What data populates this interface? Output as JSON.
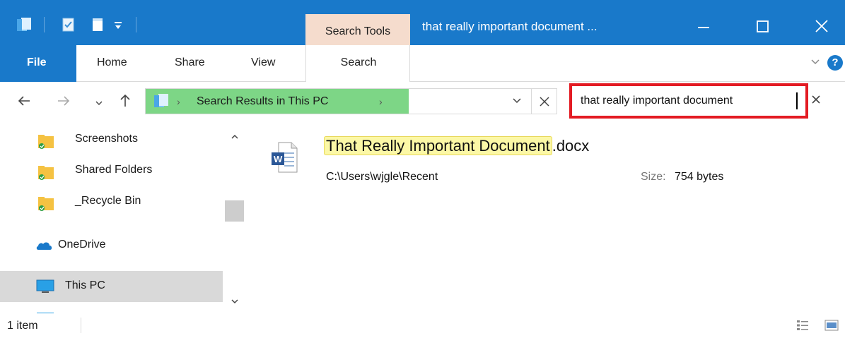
{
  "titlebar": {
    "contextual_tab": "Search Tools",
    "window_title": "that really important document ...",
    "minimize_glyph": "—",
    "maximize_glyph": "☐",
    "close_glyph": "✕",
    "icons": [
      "window-icon",
      "properties-icon",
      "new-folder-icon",
      "customize-qat-icon"
    ]
  },
  "ribbon": {
    "tabs": [
      "File",
      "Home",
      "Share",
      "View",
      "Search"
    ],
    "active_color": "#1979ca",
    "contextual_color": "#f5dccd"
  },
  "address": {
    "breadcrumb": "Search Results in This PC",
    "highlight_color": "#7dd686"
  },
  "search": {
    "query": "that really important document",
    "outline_color": "#e31b23"
  },
  "navpane": {
    "items": [
      {
        "label": "Screenshots",
        "icon": "shared-folder-icon"
      },
      {
        "label": "Shared Folders",
        "icon": "shared-folder-icon"
      },
      {
        "label": "_Recycle Bin",
        "icon": "shared-folder-icon"
      },
      {
        "label": "OneDrive",
        "icon": "onedrive-icon"
      },
      {
        "label": "This PC",
        "icon": "this-pc-icon"
      }
    ]
  },
  "results": [
    {
      "name_highlight": "That Really Important Document",
      "name_rest": ".docx",
      "path": "C:\\Users\\wjgle\\Recent",
      "size_label": "Size:",
      "size_value": "754 bytes",
      "icon": "word-document-icon",
      "highlight_color": "#fcf8a6"
    }
  ],
  "statusbar": {
    "item_count": "1 item",
    "view_icons": [
      "details-view-icon",
      "large-icons-view-icon"
    ]
  }
}
